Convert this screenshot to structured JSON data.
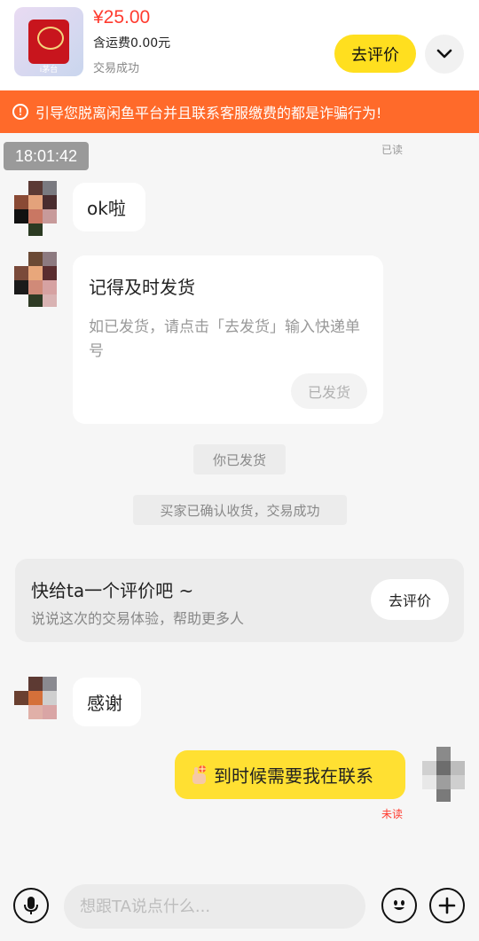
{
  "product": {
    "price": "¥25.00",
    "shipping": "含运费0.00元",
    "status": "交易成功",
    "thumb_caption": "i茅台",
    "review_button": "去评价"
  },
  "warning": {
    "text": "引导您脱离闲鱼平台并且联系客服缴费的都是诈骗行为!"
  },
  "chat": {
    "read_tag": "已读",
    "timestamp": "18:01:42",
    "msg_ok": "ok啦",
    "ship_card": {
      "title": "记得及时发货",
      "body": "如已发货，请点击「去发货」输入快递单号",
      "button": "已发货"
    },
    "sys_shipped": "你已发货",
    "sys_confirmed": "买家已确认收货，交易成功",
    "rate_card": {
      "title": "快给ta一个评价吧 ~",
      "subtitle": "说说这次的交易体验，帮助更多人",
      "button": "去评价"
    },
    "msg_thanks": "感谢",
    "my_msg": "到时候需要我在联系",
    "unread_tag": "未读"
  },
  "input": {
    "placeholder": "想跟TA说点什么..."
  },
  "colors": {
    "accent_yellow": "#ffdf1f",
    "warning_orange": "#ff6a2a",
    "price_red": "#ff3b2f"
  }
}
